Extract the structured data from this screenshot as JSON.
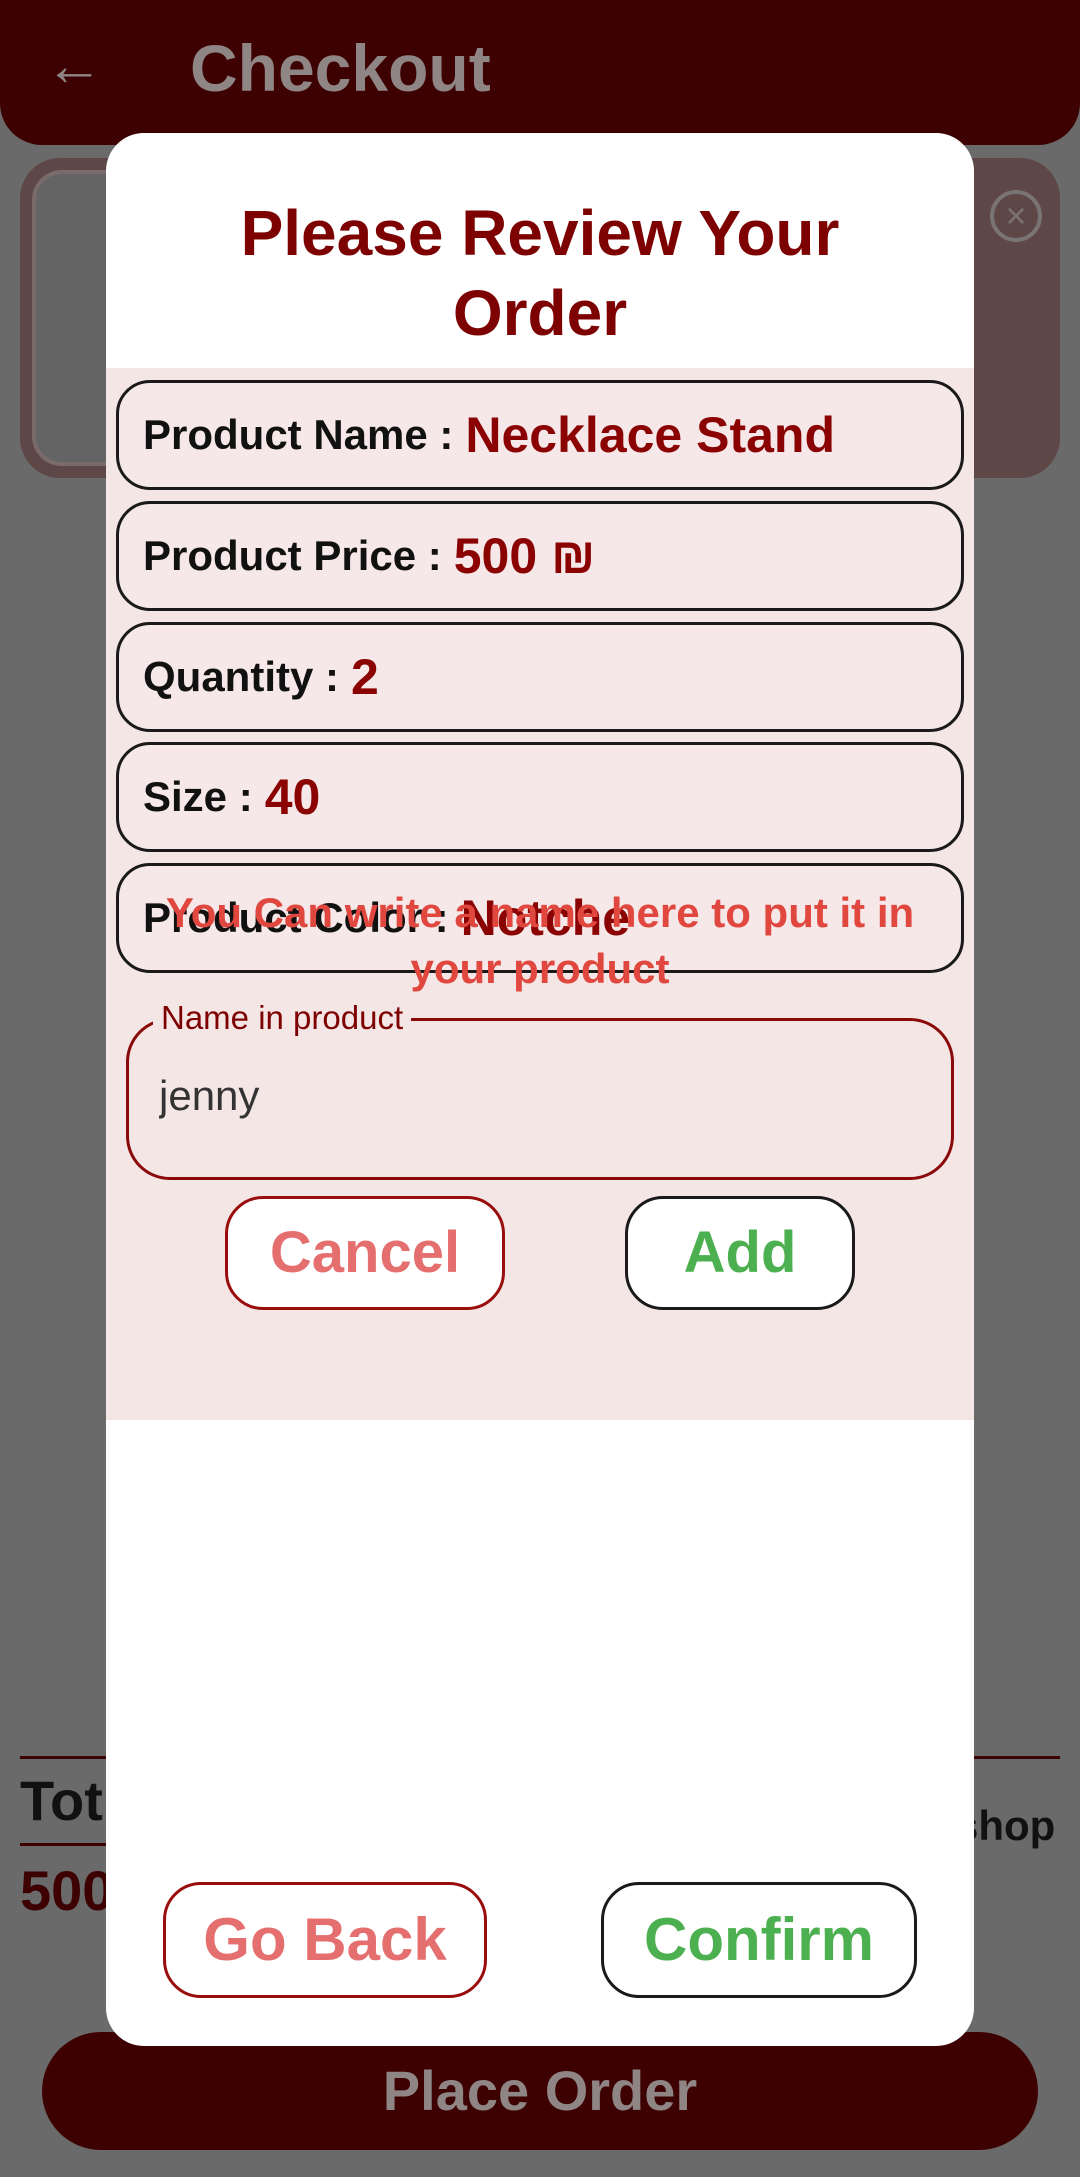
{
  "appbar": {
    "title": "Checkout",
    "back_icon": "arrow-left-icon"
  },
  "background": {
    "total_label": "Tot",
    "total_value": "500",
    "shop_text": "shop",
    "remove_icon": "close-circle-icon",
    "place_order_label": "Place Order"
  },
  "dialog": {
    "title": "Please Review Your Order",
    "fields": [
      {
        "label": "Product Name :",
        "value": "Necklace Stand"
      },
      {
        "label": "Product Price :",
        "value": "500 ₪"
      },
      {
        "label": "Quantity :",
        "value": "2"
      },
      {
        "label": "Size :",
        "value": "40"
      },
      {
        "label": "Product Color :",
        "value": "Notche"
      }
    ],
    "hint": "You Can write a name here to put it in your product",
    "name_input": {
      "label": "Name in product",
      "value": "jenny"
    },
    "cancel_label": "Cancel",
    "add_label": "Add",
    "go_back_label": "Go Back",
    "confirm_label": "Confirm"
  },
  "colors": {
    "primary_dark": "#3d0101",
    "title_red": "#7d0101",
    "hint_red": "#e0473f",
    "cancel_text": "#e56f6f",
    "confirm_green": "#4caf50",
    "review_bg": "#f5e6e6",
    "scrim": "#6a6a6a"
  }
}
